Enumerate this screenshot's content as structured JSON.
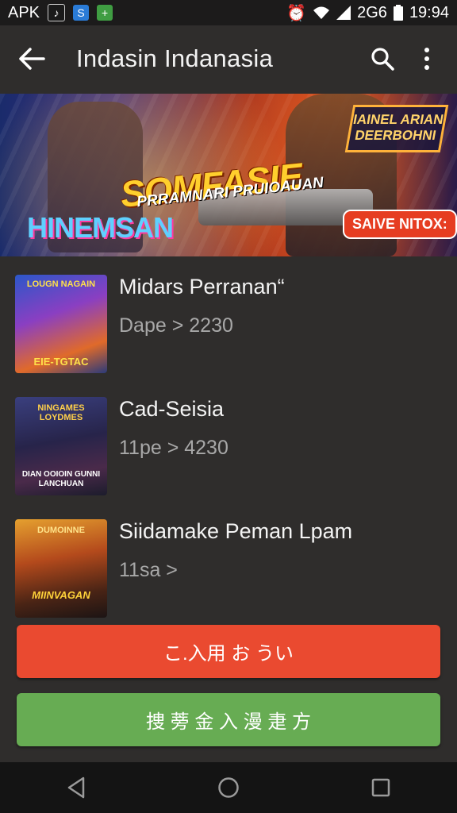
{
  "status_bar": {
    "carrier_label": "APK",
    "network": "2G6",
    "time": "19:94"
  },
  "app_bar": {
    "title": "Indasin Indanasia",
    "icons": [
      "back-arrow-icon",
      "search-icon",
      "more-vert-icon"
    ]
  },
  "banner": {
    "headline": "SOMFASIE",
    "subline": "PRRAMNARI PRUIOAUAN",
    "left_text": "HINEMSAN",
    "corner_text": "IAINEL ARIAN DEERBOHNI",
    "badge": "SAIVE NITOX:"
  },
  "list": {
    "items": [
      {
        "title": "Midars Perranan“",
        "subtitle": "Dape > 2230",
        "thumb_text_top": "LOUGN NAGAIN",
        "thumb_text_bottom": "EIE-TGTAC"
      },
      {
        "title": "Cad-Seisia",
        "subtitle": "11pe > 4230",
        "thumb_text_top": "NINGAMES LOYDMES",
        "thumb_text_bottom": "DIAN OOIOIN GUNNI LANCHUAN"
      },
      {
        "title": "Siidamake Peman Lpam",
        "subtitle": "11sa >",
        "thumb_text_top": "DUMOINNE",
        "thumb_text_bottom": "MIINVAGAN"
      }
    ]
  },
  "buttons": {
    "primary_label": "こ.入用 お うい",
    "secondary_label": "捜 蒡 金 入 漫 疌 方"
  },
  "colors": {
    "background": "#2f2d2c",
    "primary": "#ea4a30",
    "secondary": "#67ac53"
  }
}
